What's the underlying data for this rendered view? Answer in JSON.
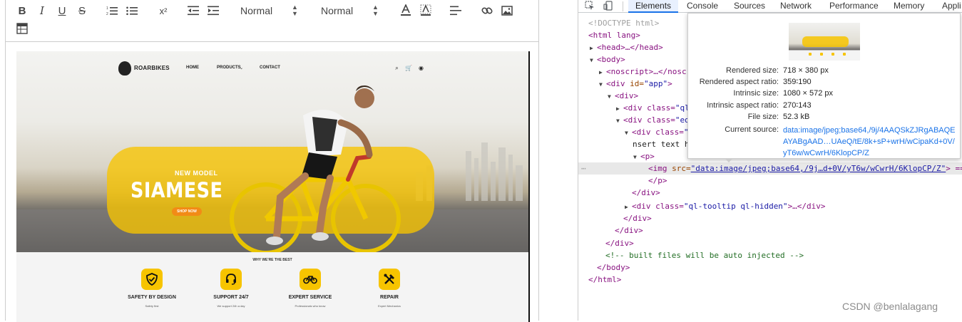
{
  "editor": {
    "toolbar": {
      "header_select": "Normal",
      "size_select": "Normal",
      "superscript": "x²"
    },
    "image": {
      "nav": {
        "logo": "ROARBIKES",
        "links": [
          "HOME",
          "PRODUCTS",
          "CONTACT"
        ]
      },
      "promo": {
        "subtitle": "NEW MODEL",
        "title": "SIAMESE",
        "button": "SHOP NOW"
      },
      "section_title": "WHY WE'RE THE BEST",
      "features": [
        {
          "title": "SAFETY BY DESIGN",
          "subtitle": "Safety first",
          "icon": "shield-check-icon"
        },
        {
          "title": "SUPPORT 24/7",
          "subtitle": "We support 24h a day",
          "icon": "headset-icon"
        },
        {
          "title": "EXPERT SERVICE",
          "subtitle": "Professionals who know",
          "icon": "bicycle-icon"
        },
        {
          "title": "REPAIR",
          "subtitle": "Expert Mechanics",
          "icon": "tools-icon"
        }
      ],
      "colors": {
        "accent": "#f7c400",
        "button": "#f28b16"
      }
    }
  },
  "devtools": {
    "tabs": [
      "Elements",
      "Console",
      "Sources",
      "Network",
      "Performance",
      "Memory",
      "Appli"
    ],
    "active_tab": "Elements",
    "tree": {
      "doctype": "<!DOCTYPE html>",
      "html_open": "<html lang>",
      "head": "<head>…</head>",
      "body_open": "<body>",
      "noscript": "<noscript>…</noscr",
      "div_app_tag": "<div",
      "div_app_attr": " id=",
      "div_app_val": "\"app\"",
      "div_app_close": ">",
      "div_open": "<div>",
      "div_ql_tag": "<div class=",
      "div_ql_val": "\"ql",
      "div_ed_tag": "<div class=",
      "div_ed_val": "\"ed",
      "div_inner_tag": "<div class=",
      "div_inner_val": "\"",
      "insert_text": "nsert text h",
      "p_open": "<p>",
      "img_tag": "<img ",
      "img_attr": "src=",
      "img_src": "\"data:image/jpeg;base64,/9j…d+0V/yT6w/wCwrH/6KlopCP/Z\"",
      "img_end": "> == $0",
      "p_close": "</p>",
      "div_close": "</div>",
      "tooltip_tag": "<div class=",
      "tooltip_val": "\"ql-tooltip ql-hidden\"",
      "tooltip_end": ">…</div>",
      "comment": "<!-- built files will be auto injected -->",
      "body_close": "</body>",
      "html_close": "</html>"
    },
    "popover": {
      "rows": [
        {
          "label": "Rendered size:",
          "value": "718 × 380 px"
        },
        {
          "label": "Rendered aspect ratio:",
          "value": "359∶190"
        },
        {
          "label": "Intrinsic size:",
          "value": "1080 × 572 px"
        },
        {
          "label": "Intrinsic aspect ratio:",
          "value": "270∶143"
        },
        {
          "label": "File size:",
          "value": "52.3 kB"
        }
      ],
      "source_label": "Current source:",
      "source_value": "data:image/jpeg;base64,/9j/4AAQSkZJRgABAQEAYABgAAD…UAeQ/tE/8k+sP+wrH/wCipaKd+0V/yT6w/wCwrH/6KlopCP/Z"
    }
  },
  "watermark": "CSDN @benlalagang"
}
